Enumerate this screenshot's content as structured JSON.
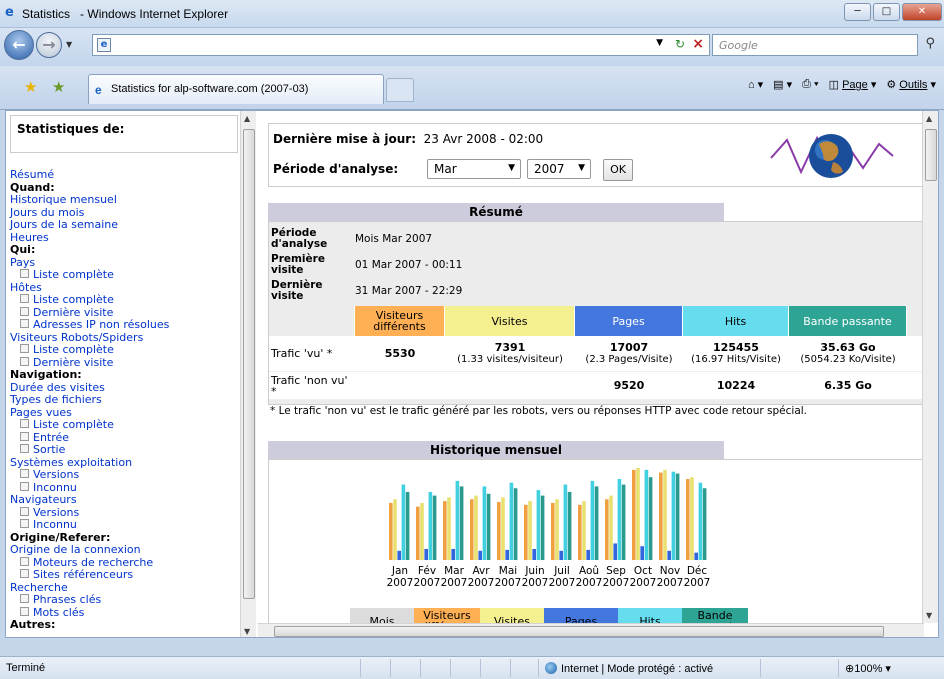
{
  "window": {
    "title": "Statistics",
    "app": "- Windows Internet Explorer"
  },
  "address": {
    "value": "",
    "search_placeholder": "Google"
  },
  "tab": {
    "label": "Statistics for alp-software.com (2007-03)"
  },
  "command_bar": {
    "page": "Page",
    "tools": "Outils"
  },
  "sidebar": {
    "header": "Statistiques de:",
    "items": [
      {
        "t": "l",
        "label": "Résumé"
      },
      {
        "t": "h",
        "label": "Quand:"
      },
      {
        "t": "l",
        "label": "Historique mensuel"
      },
      {
        "t": "l",
        "label": "Jours du mois"
      },
      {
        "t": "l",
        "label": "Jours de la semaine"
      },
      {
        "t": "l",
        "label": "Heures"
      },
      {
        "t": "h",
        "label": "Qui:"
      },
      {
        "t": "l",
        "label": "Pays"
      },
      {
        "t": "s",
        "label": "Liste complète"
      },
      {
        "t": "l",
        "label": "Hôtes"
      },
      {
        "t": "s",
        "label": "Liste complète"
      },
      {
        "t": "s",
        "label": "Dernière visite"
      },
      {
        "t": "s",
        "label": "Adresses IP non résolues"
      },
      {
        "t": "l",
        "label": "Visiteurs Robots/Spiders"
      },
      {
        "t": "s",
        "label": "Liste complète"
      },
      {
        "t": "s",
        "label": "Dernière visite"
      },
      {
        "t": "h",
        "label": "Navigation:"
      },
      {
        "t": "l",
        "label": "Durée des visites"
      },
      {
        "t": "l",
        "label": "Types de fichiers"
      },
      {
        "t": "l",
        "label": "Pages vues"
      },
      {
        "t": "s",
        "label": "Liste complète"
      },
      {
        "t": "s",
        "label": "Entrée"
      },
      {
        "t": "s",
        "label": "Sortie"
      },
      {
        "t": "l",
        "label": "Systèmes exploitation"
      },
      {
        "t": "s",
        "label": "Versions"
      },
      {
        "t": "s",
        "label": "Inconnu"
      },
      {
        "t": "l",
        "label": "Navigateurs"
      },
      {
        "t": "s",
        "label": "Versions"
      },
      {
        "t": "s",
        "label": "Inconnu"
      },
      {
        "t": "h",
        "label": "Origine/Referer:"
      },
      {
        "t": "l",
        "label": "Origine de la connexion"
      },
      {
        "t": "s",
        "label": "Moteurs de recherche"
      },
      {
        "t": "s",
        "label": "Sites référenceurs"
      },
      {
        "t": "l",
        "label": "Recherche"
      },
      {
        "t": "s",
        "label": "Phrases clés"
      },
      {
        "t": "s",
        "label": "Mots clés"
      },
      {
        "t": "h",
        "label": "Autres:"
      }
    ]
  },
  "top": {
    "update_label": "Dernière mise à jour:",
    "update_value": "23 Avr 2008 - 02:00",
    "period_label": "Période d'analyse:",
    "month": "Mar",
    "year": "2007",
    "ok": "OK"
  },
  "summary": {
    "title": "Résumé",
    "period_label": "Période d'analyse",
    "period_value": "Mois Mar 2007",
    "first_label": "Première visite",
    "first_value": "01 Mar 2007 - 00:11",
    "last_label": "Dernière visite",
    "last_value": "31 Mar 2007 - 22:29",
    "headers": [
      "Visiteurs différents",
      "Visites",
      "Pages",
      "Hits",
      "Bande passante"
    ],
    "header_colors": [
      "#ffb055",
      "#f4f090",
      "#4477dd",
      "#66ddee",
      "#2ea495"
    ],
    "viewed_label": "Trafic 'vu' *",
    "viewed": [
      {
        "v": "5530",
        "s": ""
      },
      {
        "v": "7391",
        "s": "(1.33 visites/visiteur)"
      },
      {
        "v": "17007",
        "s": "(2.3 Pages/Visite)"
      },
      {
        "v": "125455",
        "s": "(16.97 Hits/Visite)"
      },
      {
        "v": "35.63 Go",
        "s": "(5054.23 Ko/Visite)"
      }
    ],
    "notviewed_label": "Trafic 'non vu' *",
    "notviewed": [
      "",
      "",
      "9520",
      "10224",
      "6.35 Go"
    ],
    "note": "* Le trafic 'non vu' est le trafic généré par les robots, vers ou réponses HTTP avec code retour spécial."
  },
  "history": {
    "title": "Historique mensuel",
    "legend": [
      "Mois",
      "Visiteurs différents",
      "Visites",
      "Pages",
      "Hits",
      "Bande passante"
    ]
  },
  "chart_data": {
    "type": "bar",
    "categories": [
      "Jan 2007",
      "Fév 2007",
      "Mar 2007",
      "Avr 2007",
      "Mai 2007",
      "Juin 2007",
      "Juil 2007",
      "Aoû 2007",
      "Sep 2007",
      "Oct 2007",
      "Nov 2007",
      "Déc 2007"
    ],
    "series": [
      {
        "name": "Visiteurs différents",
        "color": "#f0a040",
        "values": [
          0.62,
          0.58,
          0.64,
          0.66,
          0.63,
          0.6,
          0.62,
          0.6,
          0.66,
          0.98,
          0.95,
          0.88
        ]
      },
      {
        "name": "Visites",
        "color": "#e8e070",
        "values": [
          0.66,
          0.62,
          0.68,
          0.7,
          0.68,
          0.64,
          0.66,
          0.64,
          0.7,
          1.0,
          0.98,
          0.9
        ]
      },
      {
        "name": "Pages",
        "color": "#3366dd",
        "values": [
          0.1,
          0.12,
          0.12,
          0.1,
          0.11,
          0.12,
          0.1,
          0.11,
          0.18,
          0.15,
          0.1,
          0.08
        ]
      },
      {
        "name": "Hits",
        "color": "#40d0e0",
        "values": [
          0.82,
          0.74,
          0.86,
          0.8,
          0.84,
          0.76,
          0.82,
          0.86,
          0.88,
          0.98,
          0.96,
          0.84
        ]
      },
      {
        "name": "Bande passante",
        "color": "#2a9a8e",
        "values": [
          0.74,
          0.7,
          0.8,
          0.72,
          0.78,
          0.7,
          0.74,
          0.8,
          0.82,
          0.9,
          0.94,
          0.78
        ]
      }
    ]
  },
  "status": {
    "left": "Terminé",
    "zone": "Internet | Mode protégé : activé",
    "zoom": "100%"
  }
}
